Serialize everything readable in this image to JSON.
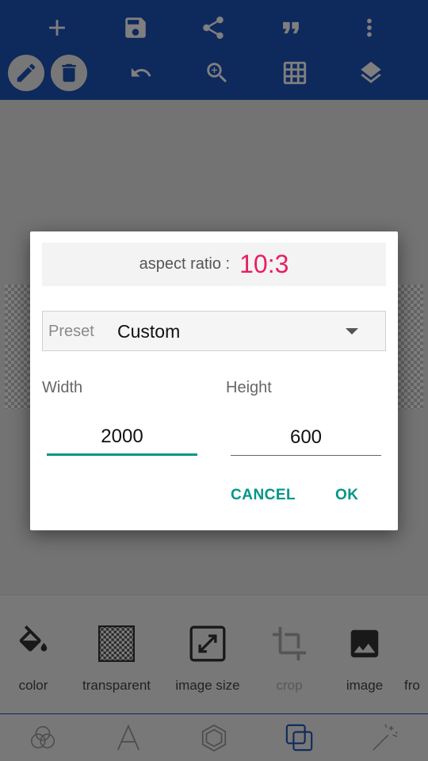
{
  "toolbar": {
    "row1": [
      "add-icon",
      "save-icon",
      "share-icon",
      "quote-icon",
      "more-vert-icon"
    ],
    "row2": [
      "pencil-icon",
      "trash-icon",
      "undo-icon",
      "zoom-in-icon",
      "grid-icon",
      "layers-icon"
    ],
    "background": "#1c52b8"
  },
  "dialog": {
    "aspect_label": "aspect ratio :",
    "aspect_value": "10:3",
    "aspect_color": "#e91e63",
    "preset_label": "Preset",
    "preset_value": "Custom",
    "width_label": "Width",
    "width_value": "2000",
    "height_label": "Height",
    "height_value": "600",
    "cancel_label": "CANCEL",
    "ok_label": "OK",
    "accent": "#009688"
  },
  "tools": [
    {
      "label": "color",
      "icon": "paint-bucket-icon"
    },
    {
      "label": "transparent",
      "icon": "checker-icon"
    },
    {
      "label": "image size",
      "icon": "resize-icon"
    },
    {
      "label": "crop",
      "icon": "crop-icon"
    },
    {
      "label": "image",
      "icon": "image-icon"
    },
    {
      "label": "fro",
      "icon": ""
    }
  ],
  "bottom_nav": [
    "color-circles-icon",
    "text-icon",
    "shape-icon",
    "layers-copy-icon",
    "magic-wand-icon"
  ]
}
